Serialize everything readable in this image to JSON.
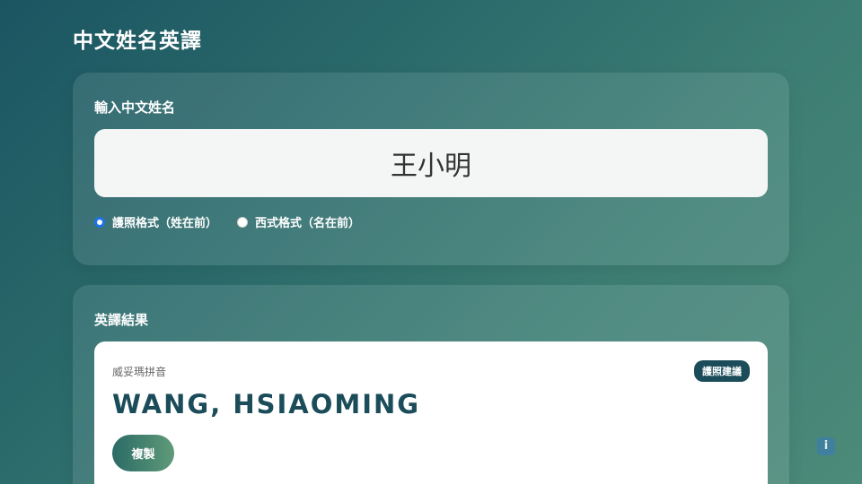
{
  "app": {
    "title": "中文姓名英譯"
  },
  "input_card": {
    "label": "輸入中文姓名",
    "name_value": "王小明",
    "options": [
      {
        "label": "護照格式（姓在前）",
        "checked": true
      },
      {
        "label": "西式格式（名在前）",
        "checked": false
      }
    ]
  },
  "result_card": {
    "label": "英譯結果",
    "system": "威妥瑪拼音",
    "badge": "護照建議",
    "name": "WANG, HSIAOMING",
    "copy_label": "複製"
  },
  "info": {
    "icon": "info-icon",
    "glyph": "i"
  },
  "colors": {
    "accent_radio": "#1e73e8",
    "brand_dark": "#1b4c5a"
  }
}
